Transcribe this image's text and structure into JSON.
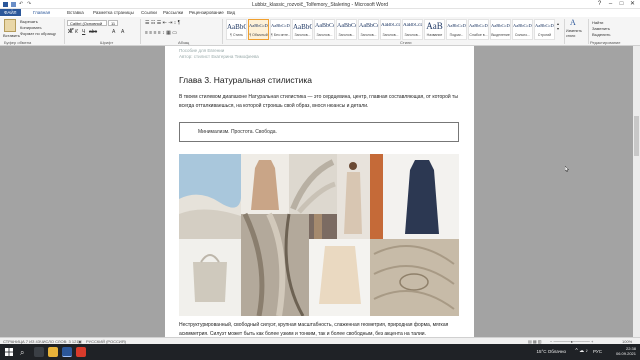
{
  "window": {
    "title": "Lubbiz_klassic_rozvoič_Tolfemory_Stalering - Microsoft Word",
    "controls": [
      "?",
      "–",
      "□",
      "✕"
    ]
  },
  "ribbon": {
    "tabs": [
      "ФАЙЛ",
      "Главная",
      "Вставка",
      "Разметка страницы",
      "Ссылки",
      "Рассылки",
      "Рецензирование",
      "Вид"
    ],
    "clipboard": {
      "paste": "Вставить",
      "cut": "Вырезать",
      "copy": "Копировать",
      "format_painter": "Формат по образцу",
      "group": "Буфер обмена"
    },
    "font": {
      "name": "Calibri (Основной те",
      "size": "11",
      "group": "Шрифт"
    },
    "paragraph_group": "Абзац",
    "styles": [
      {
        "sample": "AaBbC",
        "name": "¶ Стиль"
      },
      {
        "sample": "AaBbCcDc",
        "name": "¶ Обычный"
      },
      {
        "sample": "AaBbCcDc",
        "name": "¶ Без инте..."
      },
      {
        "sample": "AaBbC",
        "name": "Заголов..."
      },
      {
        "sample": "AaBbCc",
        "name": "Заголов..."
      },
      {
        "sample": "AaBbCc",
        "name": "Заголов..."
      },
      {
        "sample": "AaBbCc",
        "name": "Заголов..."
      },
      {
        "sample": "AaBbCcL",
        "name": "Заголов..."
      },
      {
        "sample": "AaBbCcL",
        "name": "Заголов..."
      },
      {
        "sample": "AaB",
        "name": "Название"
      },
      {
        "sample": "AaBbCcD",
        "name": "Подзаг..."
      },
      {
        "sample": "AaBbCcDc",
        "name": "Слабое в..."
      },
      {
        "sample": "AaBbCcDc",
        "name": "Выделение"
      },
      {
        "sample": "AaBbCcDc",
        "name": "Сильно..."
      },
      {
        "sample": "AaBbCcDc",
        "name": "Строгий"
      }
    ],
    "styles_group": "Стили",
    "change_styles": "Изменить стили",
    "editing": {
      "find": "Найти",
      "replace": "Заменить",
      "select": "Выделить",
      "group": "Редактирование"
    }
  },
  "document": {
    "header_line1": "Пособие для Евгении",
    "header_line2": "Автор: стилист Екатерина Тимофеева",
    "chapter_title": "Глава 3. Натуральная стилистика",
    "paragraph1": "В твоем стилевом диапазоне Натуральная стилистика — это сердцевина, центр, главная составляющая, от которой ты всегда отталкиваешься, на которой строишь свой образ, внося нюансы и детали.",
    "quote": "Минимализм. Простота. Свобода.",
    "paragraph2": "Неструктурированный, свободный силуэт, крупная масштабность, слаженная геометрия, природная форма, мягкая асимметрия. Силуэт может быть как более узким и тонким, так и более свободным, без акцента на талии."
  },
  "status": {
    "page": "СТРАНИЦА 7 ИЗ 43",
    "words": "ЧИСЛО СЛОВ: 3 121",
    "language": "РУССКИЙ (РОССИЯ)",
    "zoom": "100%"
  },
  "taskbar": {
    "search_glyph": "⌕",
    "weather": "15°C Облачно",
    "lang": "РУС",
    "time": "22:38",
    "date": "06.09.2021"
  },
  "colors": {
    "word_blue": "#2b579a",
    "accent": "#f0a030"
  }
}
